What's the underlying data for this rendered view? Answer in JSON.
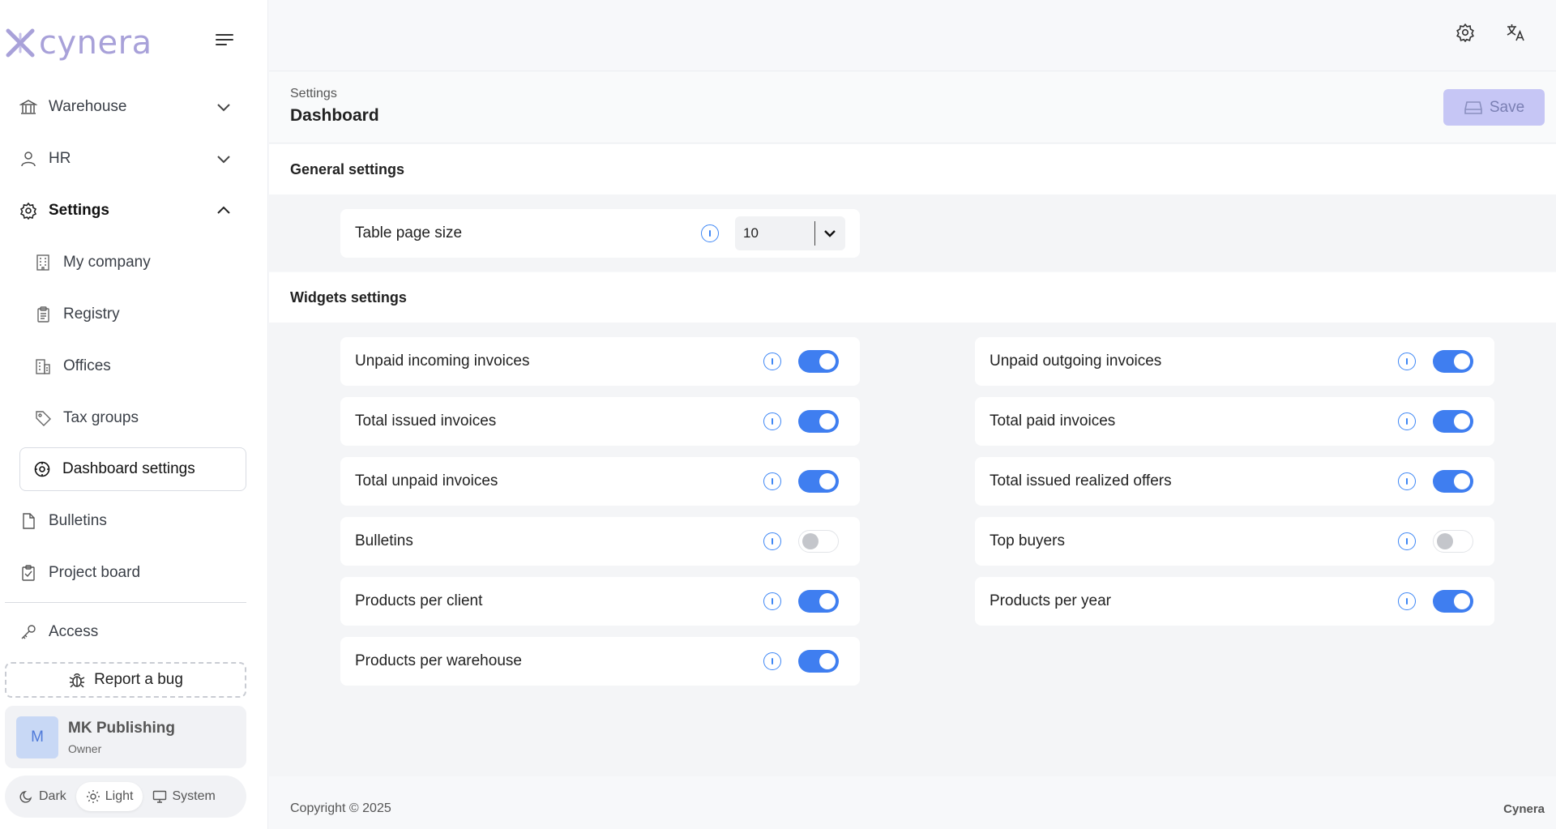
{
  "brand": {
    "logo_text": "cynera",
    "accent": "#3f7ef0",
    "logo_color": "#a8a1d9"
  },
  "sidebar": {
    "items": [
      {
        "label": "Warehouse",
        "icon": "building-columns-icon",
        "chevron": "down"
      },
      {
        "label": "HR",
        "icon": "user-icon",
        "chevron": "down"
      },
      {
        "label": "Settings",
        "icon": "gear-icon",
        "chevron": "up"
      },
      {
        "label": "My company",
        "icon": "office-building-icon"
      },
      {
        "label": "Registry",
        "icon": "clipboard-icon"
      },
      {
        "label": "Offices",
        "icon": "buildings-icon"
      },
      {
        "label": "Tax groups",
        "icon": "tag-icon"
      },
      {
        "label": "Dashboard settings",
        "icon": "dashboard-gear-icon",
        "active": true
      },
      {
        "label": "Bulletins",
        "icon": "document-icon"
      },
      {
        "label": "Project board",
        "icon": "clipboard-check-icon"
      },
      {
        "label": "Access",
        "icon": "key-icon"
      }
    ],
    "report_bug": "Report a bug",
    "user": {
      "initial": "M",
      "name": "MK Publishing",
      "role": "Owner"
    },
    "theme": {
      "dark": "Dark",
      "light": "Light",
      "system": "System",
      "selected": "Light"
    }
  },
  "header": {
    "breadcrumb": "Settings",
    "title": "Dashboard",
    "save_label": "Save"
  },
  "general": {
    "title": "General settings",
    "page_size_label": "Table page size",
    "page_size_value": "10"
  },
  "widgets": {
    "title": "Widgets settings",
    "left": [
      {
        "label": "Unpaid incoming invoices",
        "enabled": true
      },
      {
        "label": "Total issued invoices",
        "enabled": true
      },
      {
        "label": "Total unpaid invoices",
        "enabled": true
      },
      {
        "label": "Bulletins",
        "enabled": false
      },
      {
        "label": "Products per client",
        "enabled": true
      },
      {
        "label": "Products per warehouse",
        "enabled": true
      }
    ],
    "right": [
      {
        "label": "Unpaid outgoing invoices",
        "enabled": true
      },
      {
        "label": "Total paid invoices",
        "enabled": true
      },
      {
        "label": "Total issued realized offers",
        "enabled": true
      },
      {
        "label": "Top buyers",
        "enabled": false
      },
      {
        "label": "Products per year",
        "enabled": true
      }
    ]
  },
  "footer": {
    "copyright": "Copyright © 2025",
    "brand": "Cynera"
  }
}
